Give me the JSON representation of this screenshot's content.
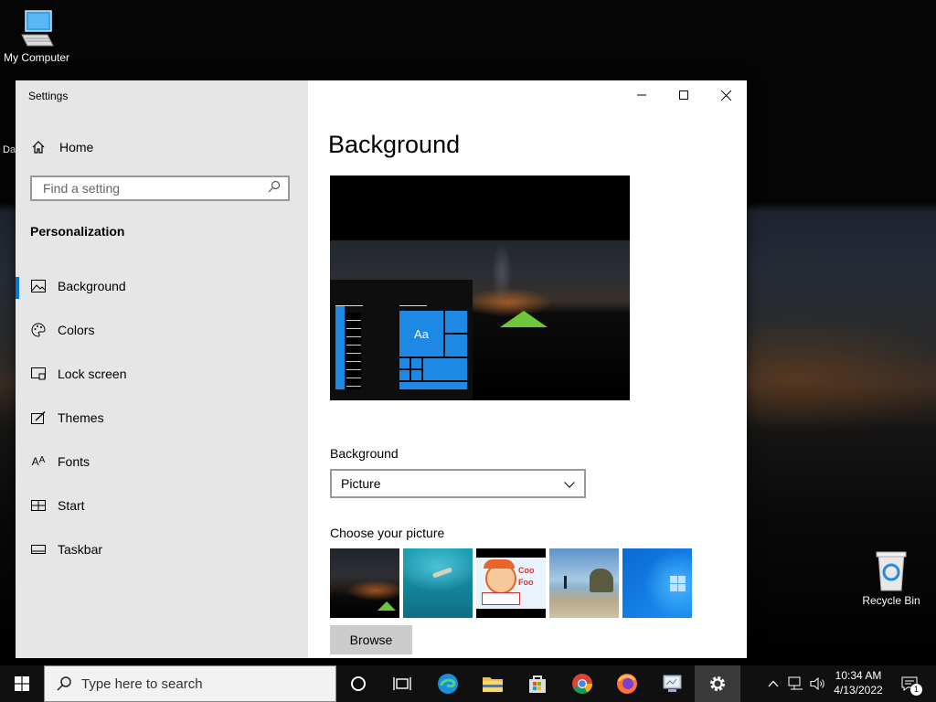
{
  "desktop": {
    "my_computer_label": "My Computer",
    "recycle_bin_label": "Recycle Bin",
    "partial_icon_label": "Da"
  },
  "window": {
    "title": "Settings",
    "home_label": "Home",
    "search_placeholder": "Find a setting",
    "section_title": "Personalization",
    "nav_items": [
      {
        "label": "Background",
        "icon": "picture-icon",
        "active": true
      },
      {
        "label": "Colors",
        "icon": "palette-icon"
      },
      {
        "label": "Lock screen",
        "icon": "lock-screen-icon"
      },
      {
        "label": "Themes",
        "icon": "themes-icon"
      },
      {
        "label": "Fonts",
        "icon": "fonts-icon"
      },
      {
        "label": "Start",
        "icon": "start-icon"
      },
      {
        "label": "Taskbar",
        "icon": "taskbar-icon"
      }
    ]
  },
  "content": {
    "heading": "Background",
    "preview_tile_text": "Aa",
    "background_label": "Background",
    "background_value": "Picture",
    "choose_label": "Choose your picture",
    "thumbnails": [
      "night-sky-tent",
      "underwater-swimmer",
      "cartoon-cookie-food",
      "beach-rocks",
      "windows-blue"
    ],
    "thumbnail_cartoon_text": "Coo Foo",
    "browse_label": "Browse"
  },
  "taskbar": {
    "search_placeholder": "Type here to search",
    "time": "10:34 AM",
    "date": "4/13/2022",
    "notification_count": "1"
  },
  "colors": {
    "accent": "#0078d4",
    "sidebar_bg": "#e6e6e6",
    "taskbar_bg": "#101010"
  }
}
